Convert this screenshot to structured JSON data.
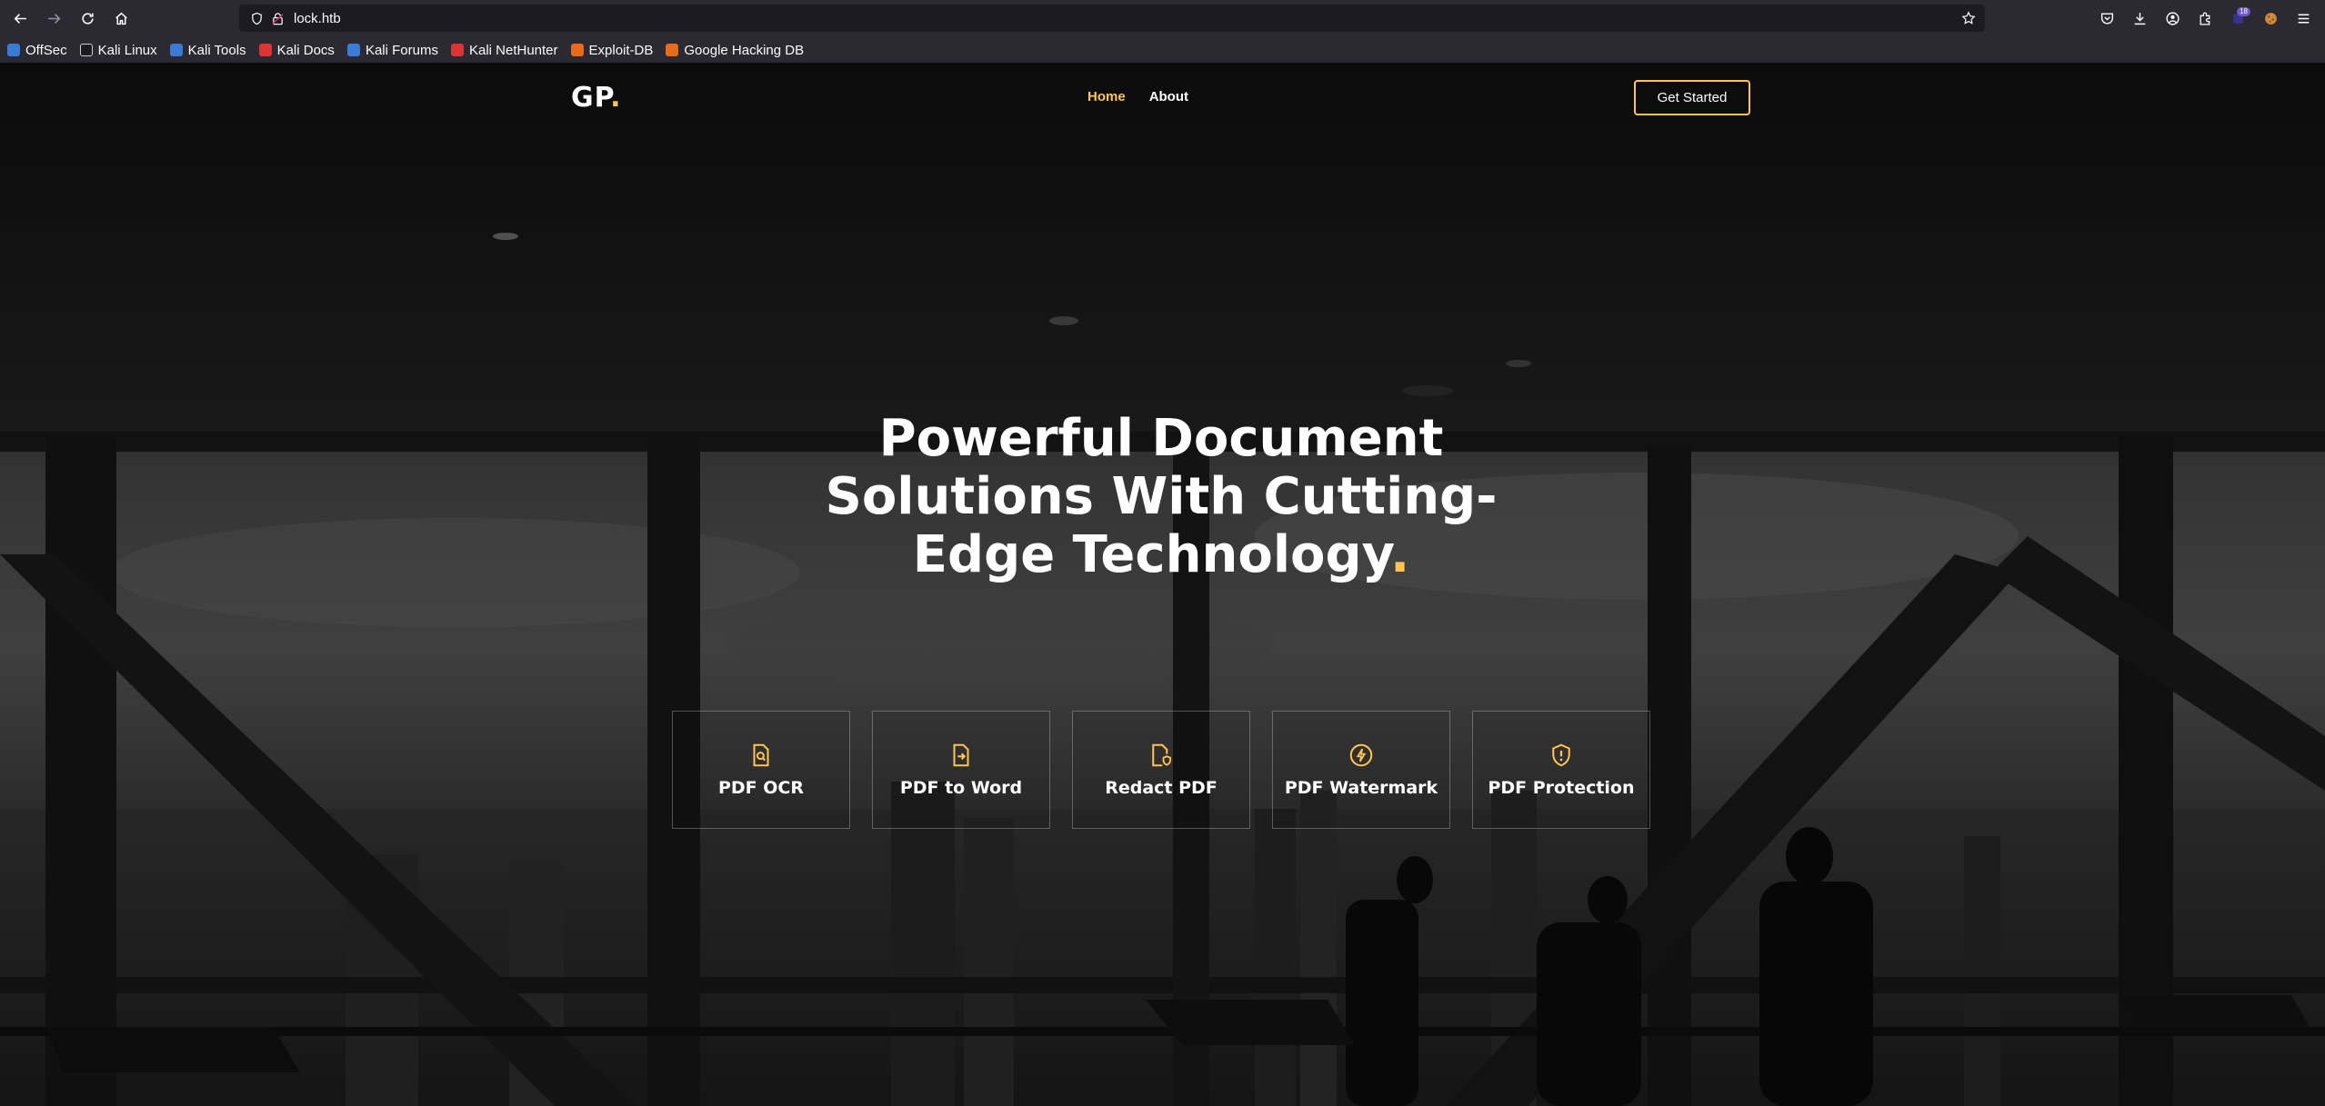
{
  "browser": {
    "url": "lock.htb",
    "extension_badge": "18",
    "bookmarks": [
      {
        "label": "OffSec",
        "color": "#3a7bd5"
      },
      {
        "label": "Kali Linux",
        "color": "#2b2a33"
      },
      {
        "label": "Kali Tools",
        "color": "#3a7bd5"
      },
      {
        "label": "Kali Docs",
        "color": "#d33"
      },
      {
        "label": "Kali Forums",
        "color": "#3a7bd5"
      },
      {
        "label": "Kali NetHunter",
        "color": "#d33"
      },
      {
        "label": "Exploit-DB",
        "color": "#e66b1f"
      },
      {
        "label": "Google Hacking DB",
        "color": "#e66b1f"
      }
    ]
  },
  "site": {
    "logo_text": "GP",
    "logo_dot": ".",
    "nav": [
      {
        "label": "Home",
        "active": true
      },
      {
        "label": "About",
        "active": false
      }
    ],
    "cta_label": "Get Started",
    "headline": "Powerful Document Solutions With Cutting-Edge Technology",
    "headline_dot": ".",
    "services": [
      {
        "label": "PDF OCR",
        "icon": "file-search-icon"
      },
      {
        "label": "PDF to Word",
        "icon": "file-arrow-icon"
      },
      {
        "label": "Redact PDF",
        "icon": "file-shield-icon"
      },
      {
        "label": "PDF Watermark",
        "icon": "lightning-icon"
      },
      {
        "label": "PDF Protection",
        "icon": "shield-exclamation-icon"
      }
    ],
    "accent_color": "#ffc451"
  }
}
